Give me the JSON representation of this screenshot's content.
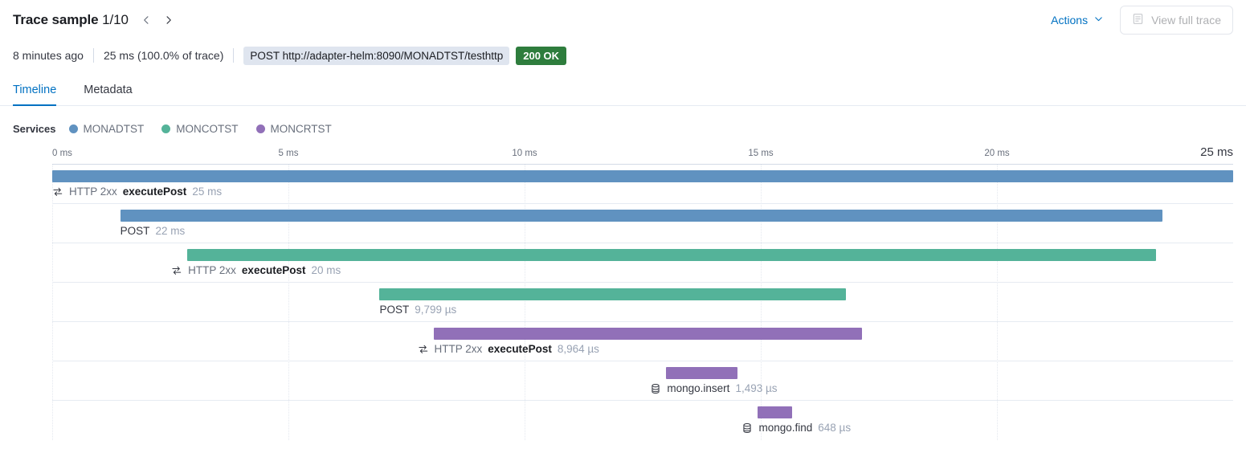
{
  "header": {
    "title_main": "Trace sample ",
    "title_fraction": "1/10",
    "prev_label": "chevron-left",
    "next_label": "chevron-right",
    "actions_label": "Actions",
    "view_full_trace_label": "View full trace"
  },
  "meta": {
    "timestamp": "8 minutes ago",
    "duration": "25 ms (100.0% of trace)",
    "url_badge": "POST http://adapter-helm:8090/MONADTST/testhttp",
    "status_badge": "200 OK"
  },
  "tabs": [
    {
      "label": "Timeline",
      "active": true
    },
    {
      "label": "Metadata",
      "active": false
    }
  ],
  "services": {
    "label": "Services",
    "items": [
      {
        "name": "MONADTST",
        "color": "#6092c0"
      },
      {
        "name": "MONCOTST",
        "color": "#54b399"
      },
      {
        "name": "MONCRTST",
        "color": "#9170b8"
      }
    ]
  },
  "chart_data": {
    "type": "bar",
    "title": "Trace timeline waterfall",
    "xlabel": "",
    "ylabel": "",
    "xlim": [
      0,
      25
    ],
    "unit": "ms",
    "grid": true,
    "axis_ticks": [
      {
        "label": "0 ms",
        "value": 0
      },
      {
        "label": "5 ms",
        "value": 5
      },
      {
        "label": "10 ms",
        "value": 10
      },
      {
        "label": "15 ms",
        "value": 15
      },
      {
        "label": "20 ms",
        "value": 20
      },
      {
        "label": "25 ms",
        "value": 25
      }
    ],
    "spans": [
      {
        "prefix": "HTTP 2xx",
        "name": "executePost",
        "duration": "25 ms",
        "icon": "transaction-icon",
        "service": "MONADTST",
        "color": "#6092c0",
        "start_ms": 0.0,
        "end_ms": 25.0,
        "bold": true
      },
      {
        "prefix": "",
        "name": "POST",
        "duration": "22 ms",
        "icon": "",
        "service": "MONADTST",
        "color": "#6092c0",
        "start_ms": 1.44,
        "end_ms": 23.5,
        "bold": false
      },
      {
        "prefix": "HTTP 2xx",
        "name": "executePost",
        "duration": "20 ms",
        "icon": "transaction-icon",
        "service": "MONCOTST",
        "color": "#54b399",
        "start_ms": 2.86,
        "end_ms": 23.36,
        "bold": true
      },
      {
        "prefix": "",
        "name": "POST",
        "duration": "9,799 µs",
        "icon": "",
        "service": "MONCOTST",
        "color": "#54b399",
        "start_ms": 6.93,
        "end_ms": 16.8,
        "bold": false
      },
      {
        "prefix": "HTTP 2xx",
        "name": "executePost",
        "duration": "8,964 µs",
        "icon": "transaction-icon",
        "service": "MONCRTST",
        "color": "#9170b8",
        "start_ms": 8.07,
        "end_ms": 17.15,
        "bold": true
      },
      {
        "prefix": "",
        "name": "mongo.insert",
        "duration": "1,493 µs",
        "icon": "database-icon",
        "service": "MONCRTST",
        "color": "#9170b8",
        "start_ms": 13.0,
        "end_ms": 14.5,
        "bold": false
      },
      {
        "prefix": "",
        "name": "mongo.find",
        "duration": "648 µs",
        "icon": "database-icon",
        "service": "MONCRTST",
        "color": "#9170b8",
        "start_ms": 14.94,
        "end_ms": 15.66,
        "bold": false
      }
    ]
  }
}
